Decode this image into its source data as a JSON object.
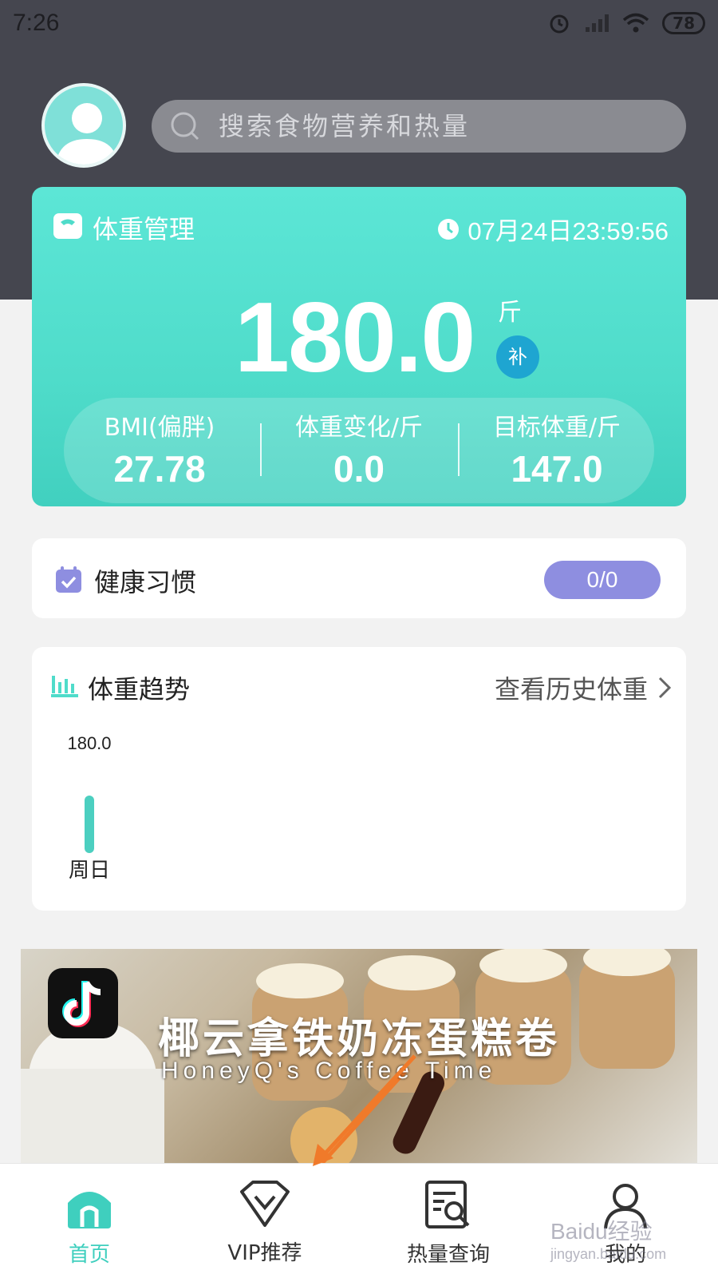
{
  "status_bar": {
    "time": "7:26",
    "battery": "78"
  },
  "search": {
    "placeholder": "搜索食物营养和热量"
  },
  "weight_card": {
    "title": "体重管理",
    "datetime": "07月24日23:59:56",
    "current_weight": "180.0",
    "unit": "斤",
    "supplement_badge": "补",
    "stats": [
      {
        "label": "BMI(偏胖)",
        "value": "27.78"
      },
      {
        "label": "体重变化/斤",
        "value": "0.0"
      },
      {
        "label": "目标体重/斤",
        "value": "147.0"
      }
    ]
  },
  "habits": {
    "title": "健康习惯",
    "progress": "0/0"
  },
  "trend": {
    "title": "体重趋势",
    "history_link": "查看历史体重",
    "chart_data": {
      "type": "bar",
      "categories": [
        "周日"
      ],
      "values": [
        180.0
      ],
      "data_labels": [
        "180.0"
      ]
    }
  },
  "banner": {
    "title": "椰云拿铁奶冻蛋糕卷",
    "subtitle": "HoneyQ's Coffee Time"
  },
  "tabs": [
    {
      "label": "首页",
      "icon": "home-icon",
      "active": true
    },
    {
      "label": "VIP推荐",
      "icon": "vip-icon",
      "active": false
    },
    {
      "label": "热量查询",
      "icon": "calorie-search-icon",
      "active": false
    },
    {
      "label": "我的",
      "icon": "profile-icon",
      "active": false
    }
  ],
  "watermark": {
    "brand": "Baidu经验",
    "domain": "jingyan.baidu.com"
  },
  "colors": {
    "accent": "#4fdcca",
    "header": "#45464f",
    "habit_badge": "#8e8ee0",
    "annotation_arrow": "#f07a2a"
  }
}
